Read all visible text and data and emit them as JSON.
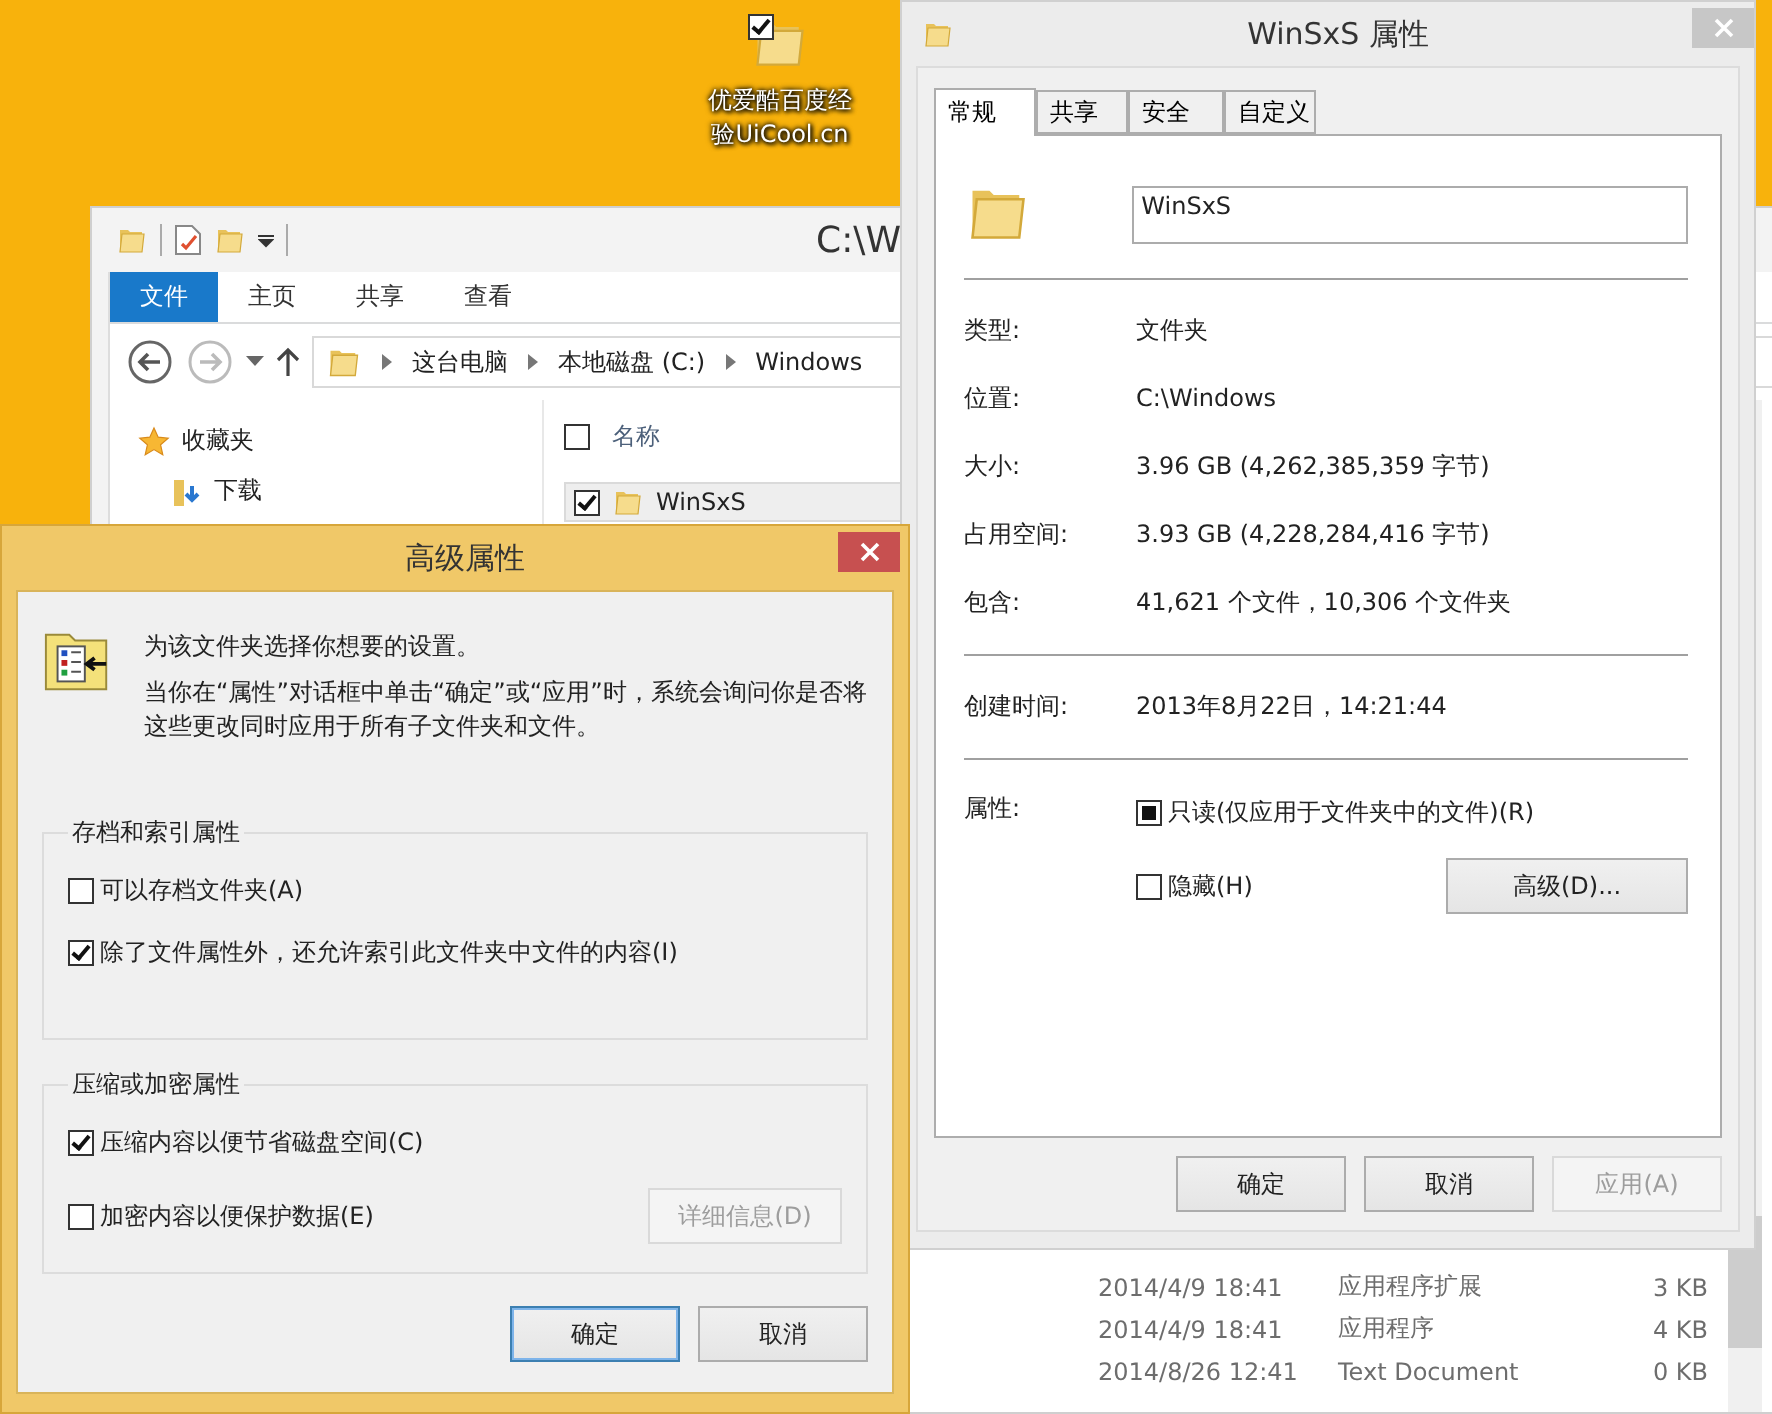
{
  "desktop_icon": {
    "label": "优爱酷百度经验UiCool.cn",
    "checked": true
  },
  "explorer": {
    "title": "C:\\W",
    "ribbon_tabs": [
      {
        "label": "文件",
        "selected": true
      },
      {
        "label": "主页",
        "selected": false
      },
      {
        "label": "共享",
        "selected": false
      },
      {
        "label": "查看",
        "selected": false
      }
    ],
    "breadcrumbs": [
      "这台电脑",
      "本地磁盘 (C:)",
      "Windows"
    ],
    "nav_items": [
      {
        "label": "收藏夹",
        "kind": "favorites"
      },
      {
        "label": "下载",
        "kind": "downloads"
      }
    ],
    "column_header": "名称",
    "header_checked": false,
    "rows": [
      {
        "name": "WinSxS",
        "selected": true,
        "checked": true
      }
    ],
    "bottom_rows": [
      {
        "date": "2014/4/9 18:41",
        "type": "应用程序扩展",
        "size": "3 KB"
      },
      {
        "date": "2014/4/9 18:41",
        "type": "应用程序",
        "size": "4 KB"
      },
      {
        "date": "2014/8/26 12:41",
        "type": "Text Document",
        "size": "0 KB"
      }
    ]
  },
  "properties": {
    "title": "WinSxS 属性",
    "tabs": [
      {
        "label": "常规",
        "selected": true
      },
      {
        "label": "共享",
        "selected": false
      },
      {
        "label": "安全",
        "selected": false
      },
      {
        "label": "自定义",
        "selected": false
      }
    ],
    "name_value": "WinSxS",
    "info_groups": [
      [
        {
          "label": "类型:",
          "value": "文件夹"
        },
        {
          "label": "位置:",
          "value": "C:\\Windows"
        },
        {
          "label": "大小:",
          "value": "3.96 GB (4,262,385,359 字节)"
        },
        {
          "label": "占用空间:",
          "value": "3.93 GB (4,228,284,416 字节)"
        },
        {
          "label": "包含:",
          "value": "41,621 个文件，10,306 个文件夹"
        }
      ],
      [
        {
          "label": "创建时间:",
          "value": "2013年8月22日，14:21:44"
        }
      ]
    ],
    "attributes_label": "属性:",
    "attributes": [
      {
        "label": "只读(仅应用于文件夹中的文件)(R)",
        "indeterminate": true
      },
      {
        "label": "隐藏(H)",
        "checked": false,
        "indeterminate": false
      }
    ],
    "advanced_button": "高级(D)...",
    "buttons": [
      {
        "label": "确定",
        "disabled": false
      },
      {
        "label": "取消",
        "disabled": false
      },
      {
        "label": "应用(A)",
        "disabled": true
      }
    ]
  },
  "advanced": {
    "title": "高级属性",
    "intro": "为该文件夹选择你想要的设置。",
    "note": "当你在“属性”对话框中单击“确定”或“应用”时，系统会询问你是否将这些更改同时应用于所有子文件夹和文件。",
    "groups": [
      {
        "title": "存档和索引属性",
        "options": [
          {
            "label": "可以存档文件夹(A)",
            "checked": false
          },
          {
            "label": "除了文件属性外，还允许索引此文件夹中文件的内容(I)",
            "checked": true
          }
        ]
      },
      {
        "title": "压缩或加密属性",
        "options": [
          {
            "label": "压缩内容以便节省磁盘空间(C)",
            "checked": true
          },
          {
            "label": "加密内容以便保护数据(E)",
            "checked": false
          }
        ],
        "details_button": {
          "label": "详细信息(D)",
          "disabled": true
        }
      }
    ],
    "buttons": [
      {
        "label": "确定",
        "default": true
      },
      {
        "label": "取消",
        "default": false
      }
    ]
  }
}
